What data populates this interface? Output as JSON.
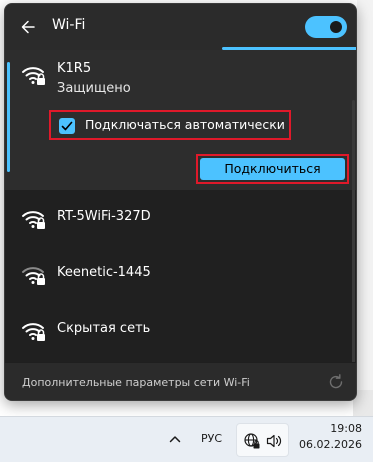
{
  "header": {
    "title": "Wi-Fi",
    "wifi_enabled": true
  },
  "networks": [
    {
      "ssid": "K1R5",
      "status": "Защищено",
      "secured": true,
      "expanded": true,
      "auto_connect_label": "Подключаться автоматически",
      "auto_connect_checked": true,
      "connect_label": "Подключиться"
    },
    {
      "ssid": "RT-5WiFi-327D",
      "secured": true
    },
    {
      "ssid": "Keenetic-1445",
      "secured": true
    },
    {
      "ssid": "Скрытая сеть",
      "secured": true
    }
  ],
  "footer": {
    "more_settings_label": "Дополнительные параметры сети Wi-Fi"
  },
  "taskbar": {
    "language": "РУС",
    "time": "19:08",
    "date": "06.02.2026"
  },
  "colors": {
    "accent": "#4cc2ff",
    "highlight_border": "#e0192a",
    "panel_bg": "#2b2b2b",
    "list_bg": "#202020"
  }
}
